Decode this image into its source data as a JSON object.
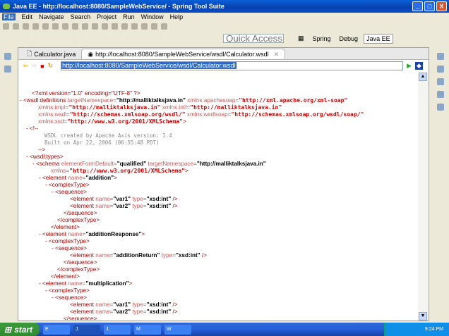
{
  "window": {
    "title": "Java EE - http://localhost:8080/SampleWebService/ - Spring Tool Suite",
    "buttons": [
      "_",
      "□",
      "X"
    ]
  },
  "menu": [
    "File",
    "Edit",
    "Navigate",
    "Search",
    "Project",
    "Run",
    "Window",
    "Help"
  ],
  "quick_access": {
    "placeholder": "Quick Access"
  },
  "perspectives": [
    {
      "label": "Spring",
      "active": false
    },
    {
      "label": "Debug",
      "active": false
    },
    {
      "label": "Java EE",
      "active": true
    }
  ],
  "tabs": [
    {
      "label": "Calculator.java",
      "active": false
    },
    {
      "label": "http://localhost:8080/SampleWebService/wsdl/Calculator.wsdl",
      "active": true,
      "close": "✕"
    }
  ],
  "browser": {
    "url": "http://localhost:8080/SampleWebService/wsdl/Calculator.wsdl"
  },
  "code_lines": [
    {
      "d": 1,
      "mk": "",
      "s": [
        [
          "m",
          "<?xml version=\"1.0\" encoding=\"UTF-8\" ?>"
        ]
      ]
    },
    {
      "d": 0,
      "mk": "- ",
      "s": [
        [
          "m",
          "<wsdl:definitions "
        ],
        [
          "a",
          "targetNamespace="
        ],
        [
          "v",
          "\"http://malliktalksjava.in\""
        ],
        [
          "a",
          " xmlns:apachesoap="
        ],
        [
          "n",
          "\"http://xml.apache.org/xml-soap\""
        ]
      ]
    },
    {
      "d": 2,
      "mk": "",
      "s": [
        [
          "a",
          "xmlns:impl="
        ],
        [
          "n",
          "\"http://malliktalksjava.in\""
        ],
        [
          "a",
          " xmlns:intf="
        ],
        [
          "n",
          "\"http://malliktalksjava.in\""
        ]
      ]
    },
    {
      "d": 2,
      "mk": "",
      "s": [
        [
          "a",
          "xmlns:wsdl="
        ],
        [
          "n",
          "\"http://schemas.xmlsoap.org/wsdl/\""
        ],
        [
          "a",
          " xmlns:wsdlsoap="
        ],
        [
          "n",
          "\"http://schemas.xmlsoap.org/wsdl/soap/\""
        ]
      ]
    },
    {
      "d": 2,
      "mk": "",
      "s": [
        [
          "a",
          "xmlns:xsd="
        ],
        [
          "n",
          "\"http://www.w3.org/2001/XMLSchema\""
        ],
        [
          "m",
          ">"
        ]
      ]
    },
    {
      "d": 1,
      "mk": "- ",
      "s": [
        [
          "m",
          "<!--"
        ]
      ]
    },
    {
      "d": 3,
      "mk": "",
      "s": [
        [
          "c",
          "WSDL created by Apache Axis version: 1.4"
        ]
      ]
    },
    {
      "d": 3,
      "mk": "",
      "s": [
        [
          "c",
          "Built on Apr 22, 2006 (06:55:48 PDT)"
        ]
      ]
    },
    {
      "d": 2,
      "mk": "",
      "s": [
        [
          "m",
          "-->"
        ]
      ]
    },
    {
      "d": 1,
      "mk": "- ",
      "s": [
        [
          "m",
          "<wsdl:types>"
        ]
      ]
    },
    {
      "d": 2,
      "mk": "- ",
      "s": [
        [
          "m",
          "<schema "
        ],
        [
          "a",
          "elementFormDefault="
        ],
        [
          "v",
          "\"qualified\""
        ],
        [
          "a",
          " targetNamespace="
        ],
        [
          "v",
          "\"http://malliktalksjava.in\""
        ]
      ]
    },
    {
      "d": 4,
      "mk": "",
      "s": [
        [
          "a",
          "xmlns="
        ],
        [
          "n",
          "\"http://www.w3.org/2001/XMLSchema\""
        ],
        [
          "m",
          ">"
        ]
      ]
    },
    {
      "d": 3,
      "mk": "- ",
      "s": [
        [
          "m",
          "<element "
        ],
        [
          "a",
          "name="
        ],
        [
          "v",
          "\"addition\""
        ],
        [
          "m",
          ">"
        ]
      ]
    },
    {
      "d": 4,
      "mk": "- ",
      "s": [
        [
          "m",
          "<complexType>"
        ]
      ]
    },
    {
      "d": 5,
      "mk": "- ",
      "s": [
        [
          "m",
          "<sequence>"
        ]
      ]
    },
    {
      "d": 7,
      "mk": "",
      "s": [
        [
          "m",
          "<element "
        ],
        [
          "a",
          "name="
        ],
        [
          "v",
          "\"var1\""
        ],
        [
          "a",
          " type="
        ],
        [
          "v",
          "\"xsd:int\""
        ],
        [
          "m",
          " />"
        ]
      ]
    },
    {
      "d": 7,
      "mk": "",
      "s": [
        [
          "m",
          "<element "
        ],
        [
          "a",
          "name="
        ],
        [
          "v",
          "\"var2\""
        ],
        [
          "a",
          " type="
        ],
        [
          "v",
          "\"xsd:int\""
        ],
        [
          "m",
          " />"
        ]
      ]
    },
    {
      "d": 6,
      "mk": "",
      "s": [
        [
          "m",
          "</sequence>"
        ]
      ]
    },
    {
      "d": 5,
      "mk": "",
      "s": [
        [
          "m",
          "</complexType>"
        ]
      ]
    },
    {
      "d": 4,
      "mk": "",
      "s": [
        [
          "m",
          "</element>"
        ]
      ]
    },
    {
      "d": 3,
      "mk": "- ",
      "s": [
        [
          "m",
          "<element "
        ],
        [
          "a",
          "name="
        ],
        [
          "v",
          "\"additionResponse\""
        ],
        [
          "m",
          ">"
        ]
      ]
    },
    {
      "d": 4,
      "mk": "- ",
      "s": [
        [
          "m",
          "<complexType>"
        ]
      ]
    },
    {
      "d": 5,
      "mk": "- ",
      "s": [
        [
          "m",
          "<sequence>"
        ]
      ]
    },
    {
      "d": 7,
      "mk": "",
      "s": [
        [
          "m",
          "<element "
        ],
        [
          "a",
          "name="
        ],
        [
          "v",
          "\"additionReturn\""
        ],
        [
          "a",
          " type="
        ],
        [
          "v",
          "\"xsd:int\""
        ],
        [
          "m",
          " />"
        ]
      ]
    },
    {
      "d": 6,
      "mk": "",
      "s": [
        [
          "m",
          "</sequence>"
        ]
      ]
    },
    {
      "d": 5,
      "mk": "",
      "s": [
        [
          "m",
          "</complexType>"
        ]
      ]
    },
    {
      "d": 4,
      "mk": "",
      "s": [
        [
          "m",
          "</element>"
        ]
      ]
    },
    {
      "d": 3,
      "mk": "- ",
      "s": [
        [
          "m",
          "<element "
        ],
        [
          "a",
          "name="
        ],
        [
          "v",
          "\"multiplication\""
        ],
        [
          "m",
          ">"
        ]
      ]
    },
    {
      "d": 4,
      "mk": "- ",
      "s": [
        [
          "m",
          "<complexType>"
        ]
      ]
    },
    {
      "d": 5,
      "mk": "- ",
      "s": [
        [
          "m",
          "<sequence>"
        ]
      ]
    },
    {
      "d": 7,
      "mk": "",
      "s": [
        [
          "m",
          "<element "
        ],
        [
          "a",
          "name="
        ],
        [
          "v",
          "\"var1\""
        ],
        [
          "a",
          " type="
        ],
        [
          "v",
          "\"xsd:int\""
        ],
        [
          "m",
          " />"
        ]
      ]
    },
    {
      "d": 7,
      "mk": "",
      "s": [
        [
          "m",
          "<element "
        ],
        [
          "a",
          "name="
        ],
        [
          "v",
          "\"var2\""
        ],
        [
          "a",
          " type="
        ],
        [
          "v",
          "\"xsd:int\""
        ],
        [
          "m",
          " />"
        ]
      ]
    },
    {
      "d": 6,
      "mk": "",
      "s": [
        [
          "m",
          "</sequence>"
        ]
      ]
    }
  ],
  "taskbar": {
    "start": "start",
    "tasks": [
      "E",
      "J.",
      "J.",
      "M",
      "W"
    ],
    "clock": "9:24 PM"
  }
}
